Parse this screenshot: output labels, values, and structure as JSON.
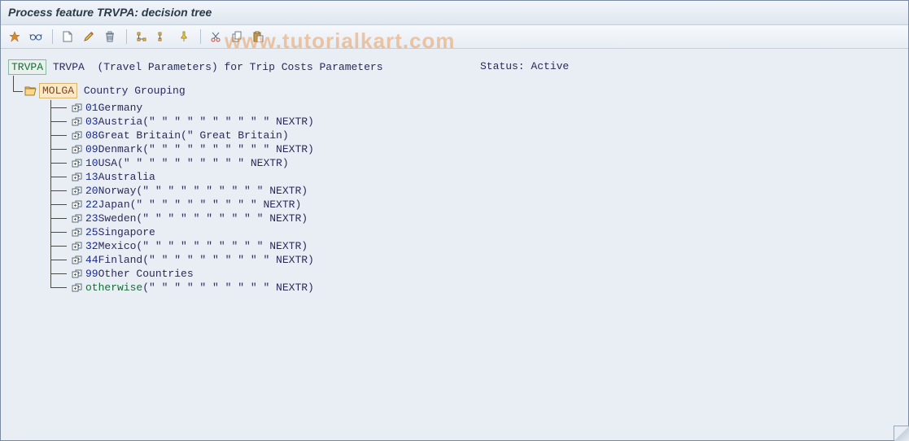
{
  "title": "Process feature TRVPA: decision tree",
  "watermark": "www.tutorialkart.com",
  "toolbar": {
    "check": "Check",
    "display": "Display",
    "create": "Create",
    "edit": "Edit",
    "delete": "Delete",
    "expand": "Expand",
    "collapse": "Collapse",
    "where": "Where-used",
    "cut": "Cut",
    "copy": "Copy",
    "paste": "Paste"
  },
  "feature": {
    "code": "TRVPA",
    "name": "TRVPA",
    "desc": "(Travel Parameters) for Trip Costs Parameters"
  },
  "status_label": "Status:",
  "status_value": "Active",
  "field": {
    "code": "MOLGA",
    "label": "Country Grouping"
  },
  "nodes": [
    {
      "code": "01",
      "label": "Germany",
      "suffix": ""
    },
    {
      "code": "03",
      "label": "Austria",
      "suffix": "(\" \" \" \" \" \" \" \" \" \" NEXTR)"
    },
    {
      "code": "08",
      "label": "Great Britain",
      "suffix": "(\" Great Britain)"
    },
    {
      "code": "09",
      "label": "Denmark",
      "suffix": "(\" \" \" \" \" \" \" \" \" \" NEXTR)"
    },
    {
      "code": "10",
      "label": "USA",
      "suffix": "(\" \" \" \" \" \" \" \" \" \" NEXTR)"
    },
    {
      "code": "13",
      "label": "Australia",
      "suffix": ""
    },
    {
      "code": "20",
      "label": "Norway",
      "suffix": "(\" \" \" \" \" \" \" \" \" \" NEXTR)"
    },
    {
      "code": "22",
      "label": "Japan",
      "suffix": "(\" \" \" \" \" \" \" \" \" \" NEXTR)"
    },
    {
      "code": "23",
      "label": "Sweden",
      "suffix": "(\" \" \" \" \" \" \" \" \" \" NEXTR)"
    },
    {
      "code": "25",
      "label": "Singapore",
      "suffix": ""
    },
    {
      "code": "32",
      "label": "Mexico",
      "suffix": "(\" \" \" \" \" \" \" \" \" \" NEXTR)"
    },
    {
      "code": "44",
      "label": "Finland",
      "suffix": "(\" \" \" \" \" \" \" \" \" \" NEXTR)"
    },
    {
      "code": "99",
      "label": "Other Countries",
      "suffix": ""
    },
    {
      "code": "otherwise",
      "label": "",
      "suffix": "(\" \" \" \" \" \" \" \" \" \" NEXTR)",
      "keyword": true
    }
  ]
}
